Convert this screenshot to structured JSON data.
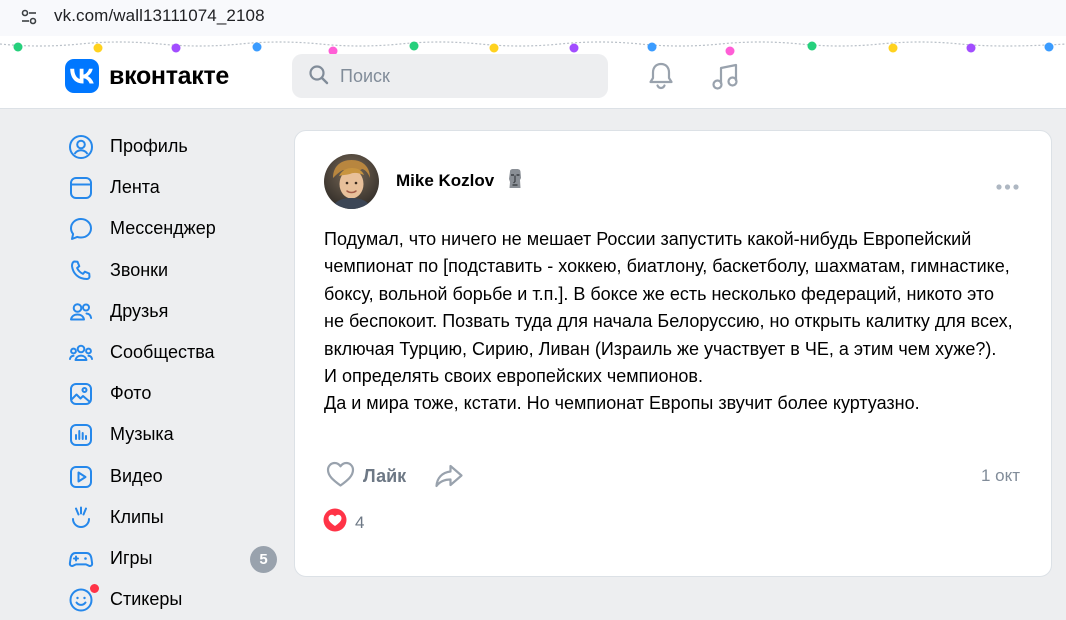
{
  "browser": {
    "url": "vk.com/wall13111074_2108"
  },
  "header": {
    "logo_text": "вконтакте",
    "search_placeholder": "Поиск"
  },
  "sidebar": {
    "items": [
      {
        "label": "Профиль",
        "icon": "profile-icon"
      },
      {
        "label": "Лента",
        "icon": "feed-icon"
      },
      {
        "label": "Мессенджер",
        "icon": "messenger-icon"
      },
      {
        "label": "Звонки",
        "icon": "phone-icon"
      },
      {
        "label": "Друзья",
        "icon": "friends-icon"
      },
      {
        "label": "Сообщества",
        "icon": "communities-icon"
      },
      {
        "label": "Фото",
        "icon": "photo-icon"
      },
      {
        "label": "Музыка",
        "icon": "music-icon"
      },
      {
        "label": "Видео",
        "icon": "video-icon"
      },
      {
        "label": "Клипы",
        "icon": "clips-icon"
      },
      {
        "label": "Игры",
        "icon": "games-icon",
        "badge": "5"
      },
      {
        "label": "Стикеры",
        "icon": "stickers-icon"
      }
    ]
  },
  "post": {
    "author": "Mike Kozlov",
    "paragraphs": [
      "Подумал, что ничего не мешает России запустить какой-нибудь Европейский чемпионат по [подставить - хоккею, биатлону, баскетболу, шахматам, гимнастике, боксу, вольной борьбе и т.п.]. В боксе же есть несколько федераций, никото это не беспокоит. Позвать туда для начала Белоруссию, но открыть калитку для всех, включая Турцию, Сирию, Ливан (Израиль же участвует в ЧЕ, а этим чем хуже?).",
      "И определять своих европейских чемпионов.",
      "Да и мира тоже, кстати. Но чемпионат Европы звучит более куртуазно."
    ],
    "like_label": "Лайк",
    "date": "1 окт",
    "reactions_count": "4"
  },
  "colors": {
    "brand": "#0077ff",
    "accent_red": "#ff3347",
    "muted_text": "#818c99"
  }
}
